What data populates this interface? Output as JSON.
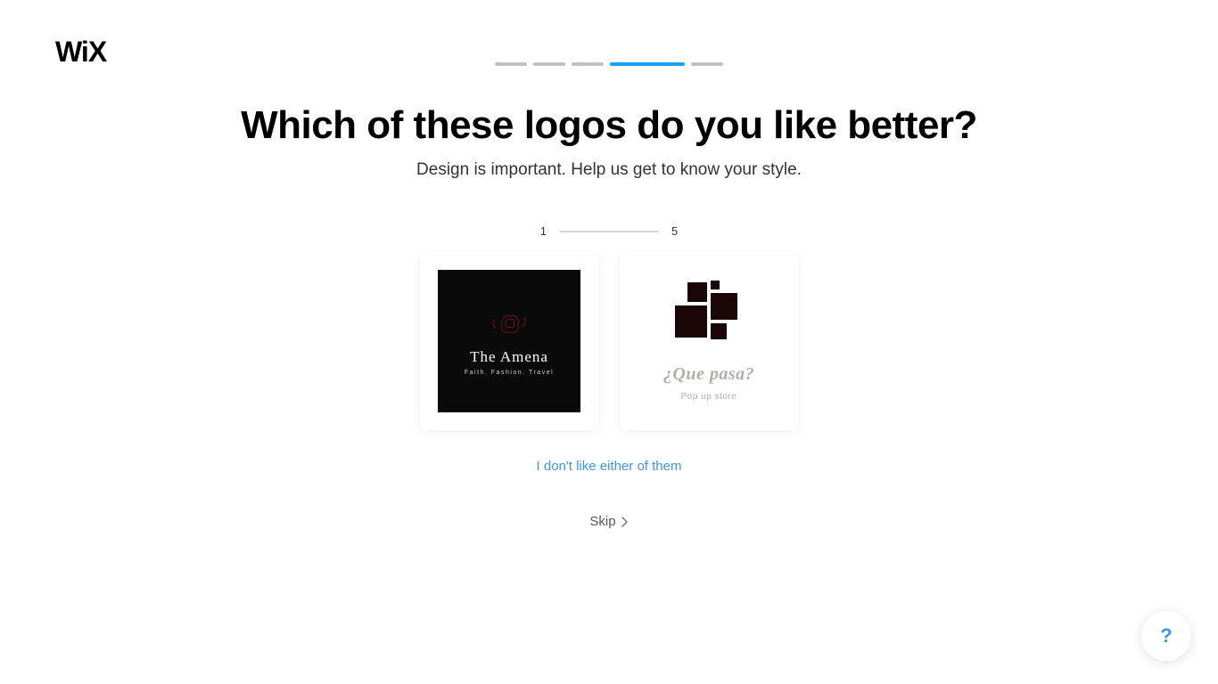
{
  "brand": "WiX",
  "progress": {
    "total": 5,
    "current": 4
  },
  "heading": "Which of these logos do you like better?",
  "subheading": "Design is important. Help us get to know your style.",
  "step": {
    "current": "1",
    "total": "5"
  },
  "options": {
    "a": {
      "title": "The Amena",
      "tagline": "Faith. Fashion. Travel"
    },
    "b": {
      "title": "¿Que pasa?",
      "tagline": "Pop up store"
    }
  },
  "dislike_label": "I don't like either of them",
  "skip_label": "Skip",
  "help_label": "?"
}
